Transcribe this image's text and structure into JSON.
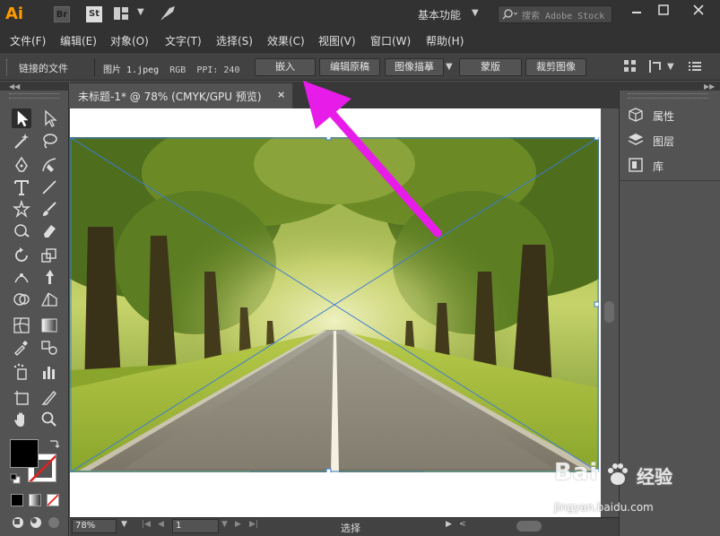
{
  "app": {
    "logo_text": "Ai",
    "bridge_label": "Br",
    "stock_label": "St",
    "workspace": "基本功能",
    "stock_search_placeholder": "搜索 Adobe Stock"
  },
  "menu": [
    {
      "label": "文件(F)"
    },
    {
      "label": "编辑(E)"
    },
    {
      "label": "对象(O)"
    },
    {
      "label": "文字(T)"
    },
    {
      "label": "选择(S)"
    },
    {
      "label": "效果(C)"
    },
    {
      "label": "视图(V)"
    },
    {
      "label": "窗口(W)"
    },
    {
      "label": "帮助(H)"
    }
  ],
  "control_bar": {
    "linked_file_label": "链接的文件",
    "file_name": "图片 1.jpeg",
    "color_mode": "RGB",
    "ppi": "PPI: 240",
    "buttons": {
      "embed": "嵌入",
      "edit_original": "编辑原稿",
      "image_trace": "图像描摹",
      "mask": "蒙版",
      "crop_image": "裁剪图像"
    }
  },
  "document": {
    "tab_title": "未标题-1* @ 78% (CMYK/GPU 预览)",
    "close_glyph": "×"
  },
  "status_bar": {
    "zoom": "78%",
    "page": "1",
    "tool_status": "选择"
  },
  "right_panel": {
    "items": [
      {
        "label": "属性"
      },
      {
        "label": "图层"
      },
      {
        "label": "库"
      }
    ]
  },
  "watermark": {
    "logo": "Bai",
    "cn": "经验",
    "url": "jingyan.baidu.com"
  },
  "colors": {
    "annotation_arrow": "#e81ce8",
    "ai_orange": "#ff9a00",
    "bbox_blue": "#3a7bd5"
  },
  "icons": {
    "selection_tool": "selection-arrow-icon",
    "direct_selection_tool": "direct-selection-icon",
    "magic_wand_tool": "magic-wand-icon",
    "lasso_tool": "lasso-icon",
    "pen_tool": "pen-icon",
    "curvature_tool": "curvature-icon",
    "type_tool": "type-icon",
    "line_tool": "line-segment-icon",
    "star_tool": "star-icon",
    "paintbrush_tool": "paintbrush-icon",
    "shaper_tool": "shaper-icon",
    "eraser_tool": "eraser-icon",
    "rotate_tool": "rotate-icon",
    "scale_tool": "scale-icon",
    "puppet_warp_tool": "puppet-warp-icon",
    "free_transform_tool": "free-transform-icon",
    "shape_builder_tool": "shape-builder-icon",
    "perspective_grid_tool": "perspective-grid-icon",
    "mesh_tool": "mesh-icon",
    "gradient_tool": "gradient-icon",
    "eyedropper_tool": "eyedropper-icon",
    "blend_tool": "blend-icon",
    "symbol_sprayer_tool": "symbol-sprayer-icon",
    "column_graph_tool": "column-graph-icon",
    "artboard_tool": "artboard-icon",
    "slice_tool": "slice-icon",
    "hand_tool": "hand-icon",
    "zoom_tool": "zoom-icon"
  }
}
